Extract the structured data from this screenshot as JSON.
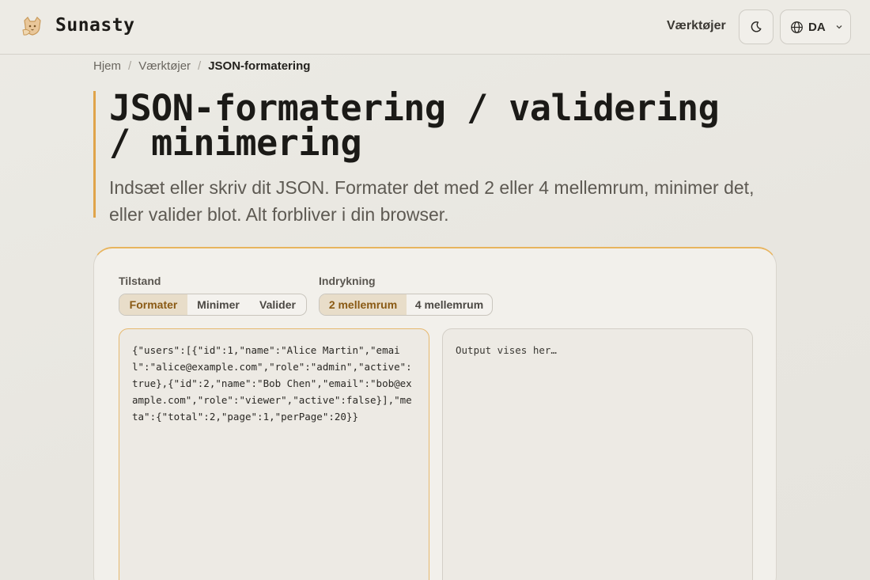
{
  "header": {
    "brand": "Sunasty",
    "nav_tools": "Værktøjer",
    "language": "DA"
  },
  "breadcrumb": {
    "home": "Hjem",
    "tools": "Værktøjer",
    "current": "JSON-formatering"
  },
  "hero": {
    "title_line1": "JSON-formatering / validering",
    "title_line2": "/ minimering",
    "subtitle": "Indsæt eller skriv dit JSON. Formater det med 2 eller 4 mellemrum, minimer det, eller valider blot. Alt forbliver i din browser."
  },
  "controls": {
    "mode_label": "Tilstand",
    "modes": [
      "Formater",
      "Minimer",
      "Valider"
    ],
    "mode_selected": "Formater",
    "indent_label": "Indrykning",
    "indents": [
      "2 mellemrum",
      "4 mellemrum"
    ],
    "indent_selected": "2 mellemrum"
  },
  "editor": {
    "input_value": "{\"users\":[{\"id\":1,\"name\":\"Alice Martin\",\"email\":\"alice@example.com\",\"role\":\"admin\",\"active\":true},{\"id\":2,\"name\":\"Bob Chen\",\"email\":\"bob@example.com\",\"role\":\"viewer\",\"active\":false}],\"meta\":{\"total\":2,\"page\":1,\"perPage\":20}}",
    "output_placeholder": "Output vises her…"
  },
  "icons": {
    "logo": "cat-logo-icon",
    "theme": "moon-icon",
    "language": "globe-icon",
    "dropdown": "chevron-down-icon"
  },
  "colors": {
    "accent": "#e0a44a",
    "active_segment_bg": "#e8ddc9",
    "active_segment_text": "#8a5a14"
  }
}
